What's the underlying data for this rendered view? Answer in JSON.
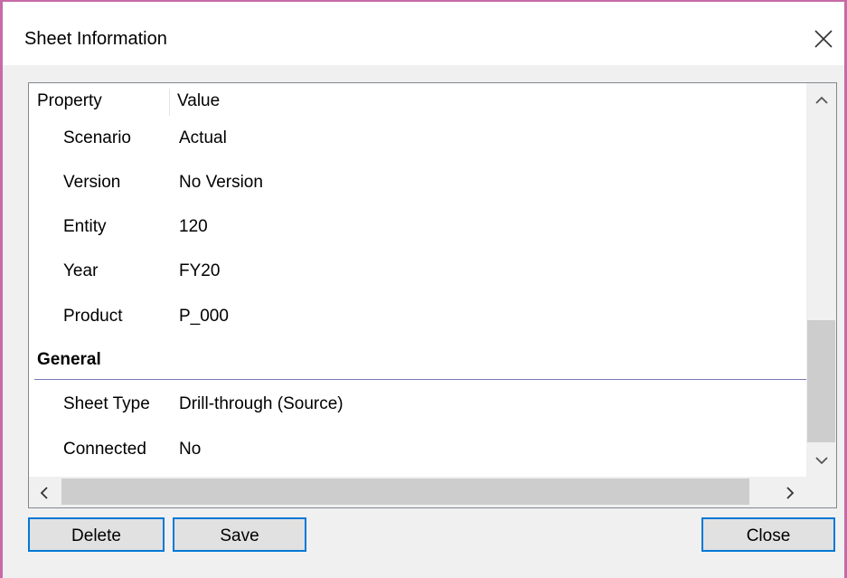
{
  "dialog": {
    "title": "Sheet Information"
  },
  "table": {
    "columns": [
      "Property",
      "Value"
    ],
    "rows": [
      {
        "name": "Scenario",
        "value": "Actual"
      },
      {
        "name": "Version",
        "value": "No Version"
      },
      {
        "name": "Entity",
        "value": "120"
      },
      {
        "name": "Year",
        "value": "FY20"
      },
      {
        "name": "Product",
        "value": "P_000"
      }
    ],
    "section": {
      "label": "General",
      "rows": [
        {
          "name": "Sheet Type",
          "value": "Drill-through (Source)"
        },
        {
          "name": "Connected",
          "value": "No"
        }
      ]
    }
  },
  "buttons": {
    "delete": "Delete",
    "save": "Save",
    "close": "Close"
  },
  "icons": {
    "close": "close-icon",
    "scroll_up": "chevron-up-icon",
    "scroll_down": "chevron-down-icon",
    "scroll_left": "chevron-left-icon",
    "scroll_right": "chevron-right-icon"
  },
  "colors": {
    "button_border": "#0078d7",
    "section_rule": "#7a7ab8"
  }
}
